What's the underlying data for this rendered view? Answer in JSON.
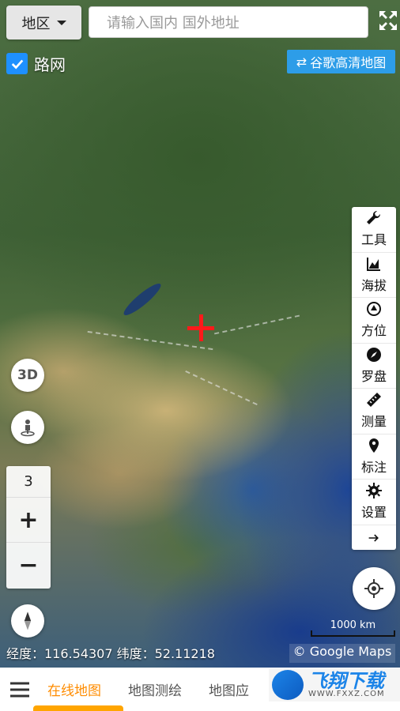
{
  "header": {
    "region_label": "地区",
    "search_placeholder": "请输入国内 国外地址"
  },
  "road_network": {
    "label": "路网",
    "checked": true
  },
  "google_hd_button": {
    "icon": "swap-icon",
    "label": "谷歌高清地图"
  },
  "toolbar": {
    "items": [
      {
        "icon": "wrench-icon",
        "label": "工具"
      },
      {
        "icon": "chart-icon",
        "label": "海拔"
      },
      {
        "icon": "bearing-icon",
        "label": "方位"
      },
      {
        "icon": "compass-icon",
        "label": "罗盘"
      },
      {
        "icon": "ruler-icon",
        "label": "测量"
      },
      {
        "icon": "marker-icon",
        "label": "标注"
      },
      {
        "icon": "gear-icon",
        "label": "设置"
      }
    ]
  },
  "map_controls": {
    "three_d_label": "3D",
    "zoom_level": "3",
    "zoom_in": "+",
    "zoom_out": "−"
  },
  "scale": {
    "label": "1000 km"
  },
  "coordinates": {
    "text": "经度：116.54307 纬度：52.11218"
  },
  "attribution": "© Google Maps",
  "bottom_nav": {
    "tabs": [
      {
        "label": "在线地图",
        "active": true
      },
      {
        "label": "地图测绘",
        "active": false
      },
      {
        "label": "地图应",
        "active": false
      }
    ]
  },
  "watermark": {
    "title": "飞翔下载",
    "subtitle": "WWW.FXXZ.COM"
  },
  "colors": {
    "accent": "#2d9de8",
    "active_tab": "#ff8c00",
    "crosshair": "#ff1a1a"
  }
}
